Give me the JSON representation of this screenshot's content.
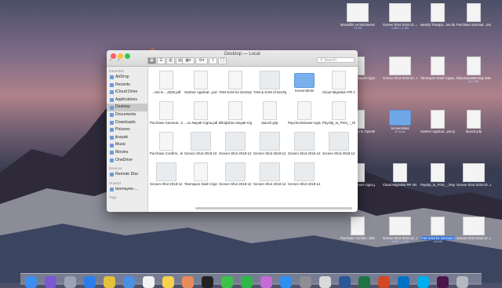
{
  "finder": {
    "title": "Desktop — Local",
    "search_placeholder": "Search",
    "nav_back": "‹",
    "nav_forward": "›",
    "sidebar": {
      "favorites_header": "Favorites",
      "favorites": [
        "AirDrop",
        "Recents",
        "iCloud Drive",
        "Applications",
        "Desktop",
        "Documents",
        "Downloads",
        "Pictures",
        "jinayak",
        "Music",
        "Movies",
        "OneDrive"
      ],
      "devices_header": "Devices",
      "devices": [
        "Remote Disc"
      ],
      "shared_header": "Shared",
      "shared": [
        "tanmayee-..."
      ],
      "tags_header": "Tags",
      "selected": "Desktop"
    },
    "files": [
      {
        "name": "...ted to ...2025.pdf",
        "kind": "doc"
      },
      {
        "name": "Gartner Applicat...port.pdf",
        "kind": "doc"
      },
      {
        "name": "TAM SAM for DevOps.docx",
        "kind": "doc"
      },
      {
        "name": "TAM & SAM of DevOps.pptx",
        "kind": "shot"
      },
      {
        "name": "Screenshots",
        "kind": "folder"
      },
      {
        "name": "Cloud Migration PR 4N Final.docx",
        "kind": "doc"
      },
      {
        "name": "Purchase Summar...nses.pdf",
        "kind": "doc"
      },
      {
        "name": "...nu Nayak-Cigna.pdf",
        "kind": "doc"
      },
      {
        "name": "Bhrajishnu Nayak-Cigna.pdf",
        "kind": "doc"
      },
      {
        "name": "launch.jnlp",
        "kind": "doc"
      },
      {
        "name": "Paycheckviewer-cigna.pdf",
        "kind": "doc"
      },
      {
        "name": "Payslip_to_Print_-_Report...2018.pdf",
        "kind": "doc"
      },
      {
        "name": "Purchase Confirm...lines.pdf",
        "kind": "doc"
      },
      {
        "name": "Screen Shot 2018-10...PM.png",
        "kind": "shot"
      },
      {
        "name": "Screen Shot 2018-12...AM.png",
        "kind": "shot"
      },
      {
        "name": "Screen Shot 2018-12...AM.png",
        "kind": "shot"
      },
      {
        "name": "Screen Shot 2018-12...AM.png",
        "kind": "shot"
      },
      {
        "name": "Screen Shot 2018-12...PM.png",
        "kind": "shot"
      },
      {
        "name": "Screen Shot 2018-12...PM.png",
        "kind": "shot"
      },
      {
        "name": "Tanmayee Dash Cigna.pdf",
        "kind": "doc"
      },
      {
        "name": "Screen Shot 2018-12...PM.png",
        "kind": "shot"
      },
      {
        "name": "Screen Shot 2018-12...PM.png",
        "kind": "shot"
      },
      {
        "name": "Screen Shot 2018-12...PM.png",
        "kind": "shot"
      },
      {
        "name": "",
        "kind": "blank"
      }
    ]
  },
  "desktop_icons": [
    {
      "name": "Mousslife vs Microservers.pptx",
      "sub": "74 KB",
      "kind": "shot",
      "hl": false
    },
    {
      "name": "Screen Shot 2018-12...AM.png",
      "sub": "3,360 × 2,100",
      "kind": "shot",
      "hl": false
    },
    {
      "name": "weekly Transpo...res.docx",
      "sub": "",
      "kind": "doc",
      "hl": false
    },
    {
      "name": "Purchase Summar...nses.pdf",
      "sub": "",
      "kind": "doc",
      "hl": false
    },
    {
      "name": "Bhrajishnu Nayak-Cigna.pdf",
      "sub": "",
      "kind": "doc",
      "hl": false
    },
    {
      "name": "Screen Shot 2018-10...PM.png",
      "sub": "",
      "kind": "shot",
      "hl": false
    },
    {
      "name": "Tanmayee Dash Cigna.pdf",
      "sub": "",
      "kind": "doc",
      "hl": false
    },
    {
      "name": "BlueJeansMeeting Installer.dmg",
      "sub": "24.7 MB",
      "kind": "doc",
      "hl": false
    },
    {
      "name": "Development to Operatio...025.pdf",
      "sub": "",
      "kind": "doc",
      "hl": false
    },
    {
      "name": "Screenshots",
      "sub": "44 items",
      "kind": "folder",
      "hl": false
    },
    {
      "name": "Gartner Applicat...port.pdf",
      "sub": "",
      "kind": "doc",
      "hl": false
    },
    {
      "name": "launch.jnlp",
      "sub": "",
      "kind": "doc",
      "hl": false
    },
    {
      "name": "Paycheckviewer-cigna.pdf",
      "sub": "",
      "kind": "doc",
      "hl": false
    },
    {
      "name": "Cloud Migration PR 4N Final.docx",
      "sub": "",
      "kind": "doc",
      "hl": false
    },
    {
      "name": "Payslip_to_Print_-_Report...2018.pdf",
      "sub": "",
      "kind": "doc",
      "hl": false
    },
    {
      "name": "Screen Shot 2018-10...PM.png",
      "sub": "",
      "kind": "shot",
      "hl": false
    },
    {
      "name": "Purchase Confirm...lines.pdf",
      "sub": "",
      "kind": "doc",
      "hl": false
    },
    {
      "name": "Screen Shot 2018-12...PM.png",
      "sub": "3,360 × 2,100",
      "kind": "shot",
      "hl": false
    },
    {
      "name": "TAM SAM for DevOps.docx",
      "sub": "144 KB",
      "kind": "doc",
      "hl": true
    },
    {
      "name": "Screen Shot 2018-12...PM.png",
      "sub": "",
      "kind": "shot",
      "hl": false
    }
  ],
  "colors": {
    "accent": "#2f6fd6",
    "folder": "#79b0ec",
    "sidebar": "#ececec",
    "sidebar_selected": "#c9c9c9"
  },
  "dock_apps": [
    "finder-icon",
    "siri-icon",
    "launchpad-icon",
    "safari-icon",
    "chrome-icon",
    "mail-icon",
    "calendar-icon",
    "notes-icon",
    "photos-icon",
    "terminal-icon",
    "messages-icon",
    "facetime-icon",
    "itunes-icon",
    "app-store-icon",
    "system-preferences-icon",
    "preview-icon",
    "word-icon",
    "excel-icon",
    "powerpoint-icon",
    "outlook-icon",
    "skype-icon",
    "slack-icon",
    "trash-icon"
  ]
}
